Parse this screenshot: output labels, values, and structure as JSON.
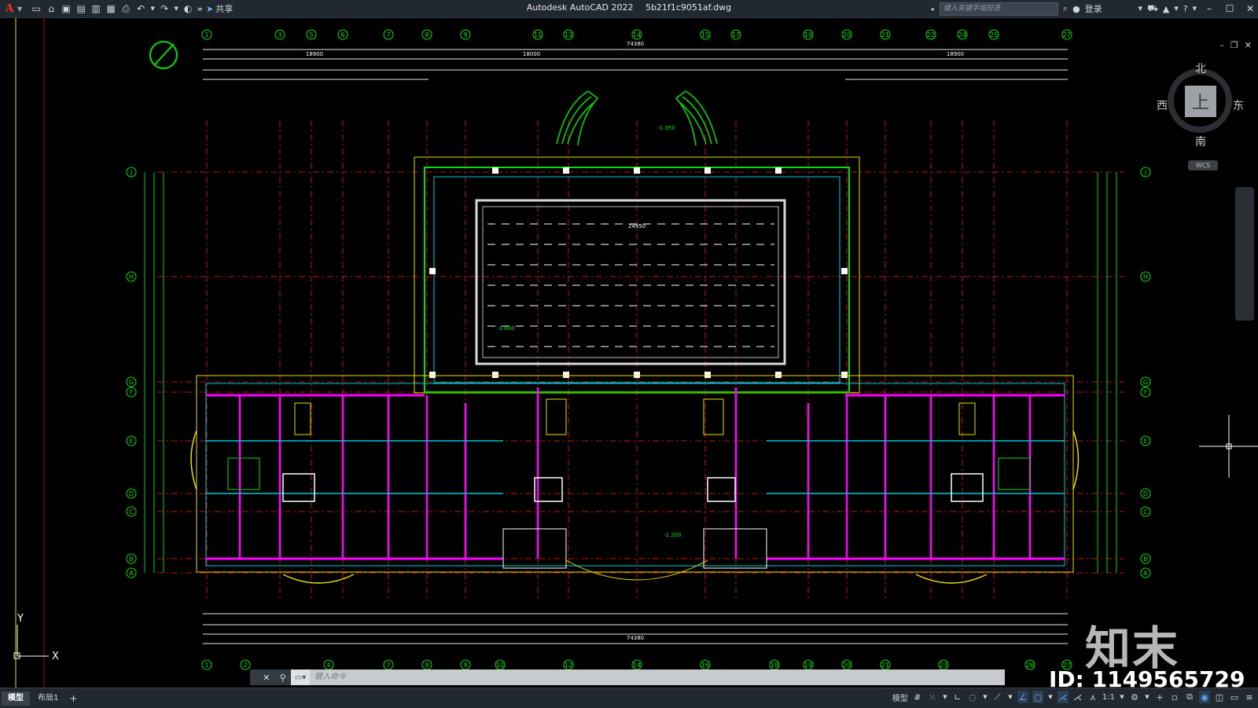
{
  "titlebar": {
    "app_name": "Autodesk AutoCAD 2022",
    "file_name": "5b21f1c9051af.dwg",
    "share_label": "共享",
    "search_placeholder": "键入关键字或短语",
    "login_label": "登录"
  },
  "viewcube": {
    "north": "北",
    "south": "南",
    "east": "东",
    "west": "西",
    "face": "上",
    "wcs": "WCS"
  },
  "drawing": {
    "grid_top": [
      "1",
      "3",
      "5",
      "6",
      "7",
      "8",
      "9",
      "11",
      "13",
      "14",
      "15",
      "17",
      "19",
      "20",
      "21",
      "22",
      "24",
      "25",
      "27"
    ],
    "grid_bottom": [
      "1",
      "2",
      "4",
      "7",
      "8",
      "9",
      "10",
      "12",
      "14",
      "16",
      "18",
      "19",
      "20",
      "21",
      "23",
      "26",
      "27"
    ],
    "grid_rows": [
      "J",
      "H",
      "G",
      "F",
      "E",
      "D",
      "C",
      "B",
      "A"
    ],
    "dim_total": "74380",
    "dim_left": "18900",
    "dim_right": "18900",
    "dim_mid": "18000",
    "pool_width": "24950",
    "level_1": "-1.350",
    "level_2": "-1.200",
    "level_3": "-3.600",
    "ucs_x": "X",
    "ucs_y": "Y"
  },
  "watermark": {
    "logo_text": "知末",
    "id_text": "ID: 1149565729"
  },
  "commandline": {
    "placeholder": "键入命令"
  },
  "statusbar": {
    "tabs": [
      "模型",
      "布局1"
    ],
    "model_label": "模型",
    "scale_label": "1:1"
  },
  "colors": {
    "background": "#000000",
    "wall_magenta": "#ff00ff",
    "dim_green": "#00ff00",
    "axis_red": "#ff2020",
    "cyan": "#00c8d8",
    "yellow": "#e8e000",
    "white": "#ffffff",
    "titlebar": "#212830"
  }
}
